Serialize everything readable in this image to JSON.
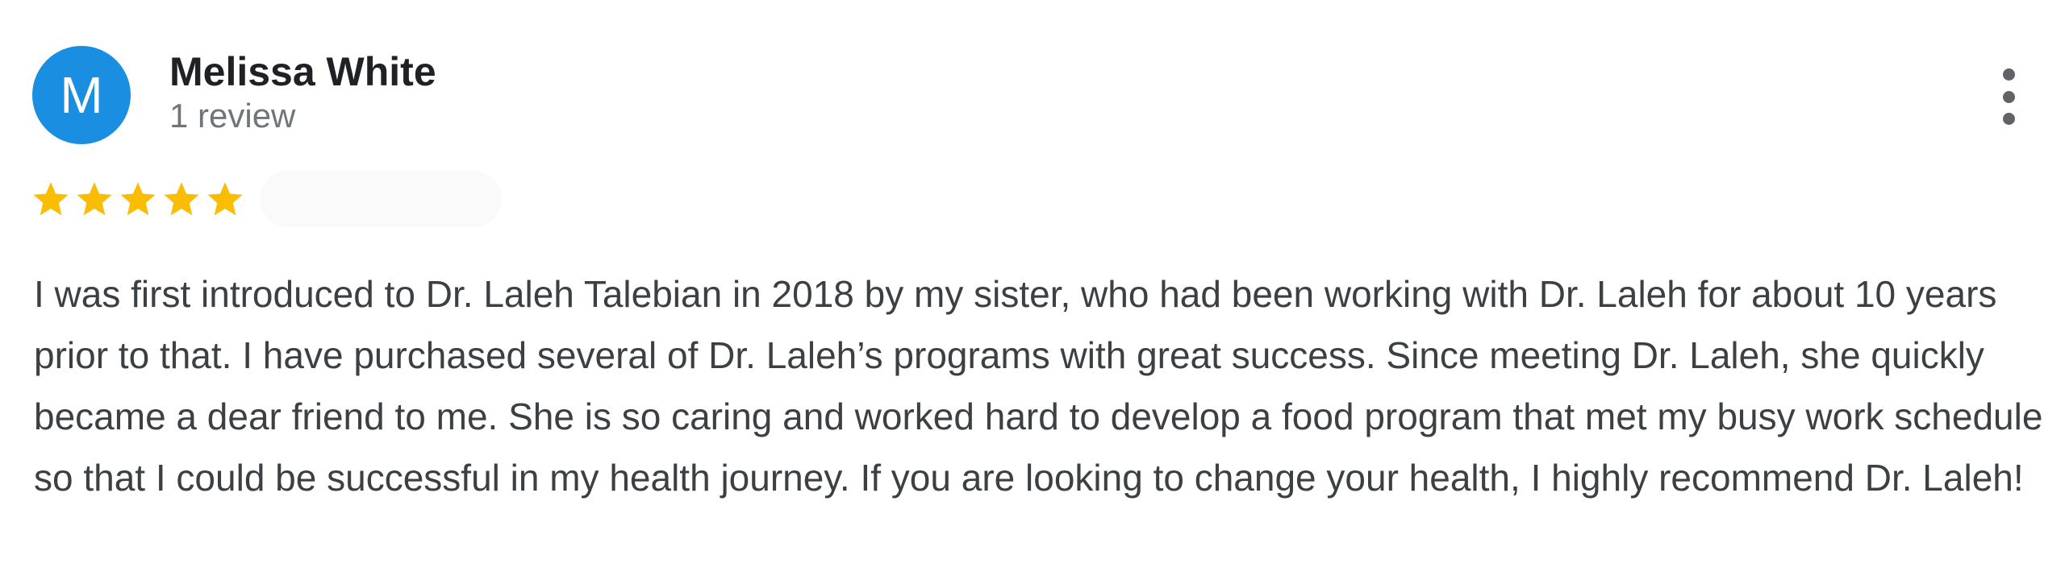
{
  "reviewer": {
    "initial": "M",
    "name": "Melissa White",
    "review_count": "1 review",
    "avatar_color": "#1a8ee0"
  },
  "rating": {
    "stars": 5,
    "max": 5,
    "star_color": "#fbbc04"
  },
  "menu": {
    "icon": "more-vert-icon"
  },
  "review": {
    "text": "I was first introduced to Dr. Laleh Talebian in 2018 by my sister, who had been working with Dr. Laleh for about 10 years prior to that. I have purchased several of Dr. Laleh’s programs with great success. Since meeting Dr. Laleh, she quickly became a dear friend to me. She is so caring and worked hard to develop a food program that met my busy work schedule so that I could be successful in my health journey. If you are looking to change your health, I highly recommend Dr. Laleh!"
  }
}
